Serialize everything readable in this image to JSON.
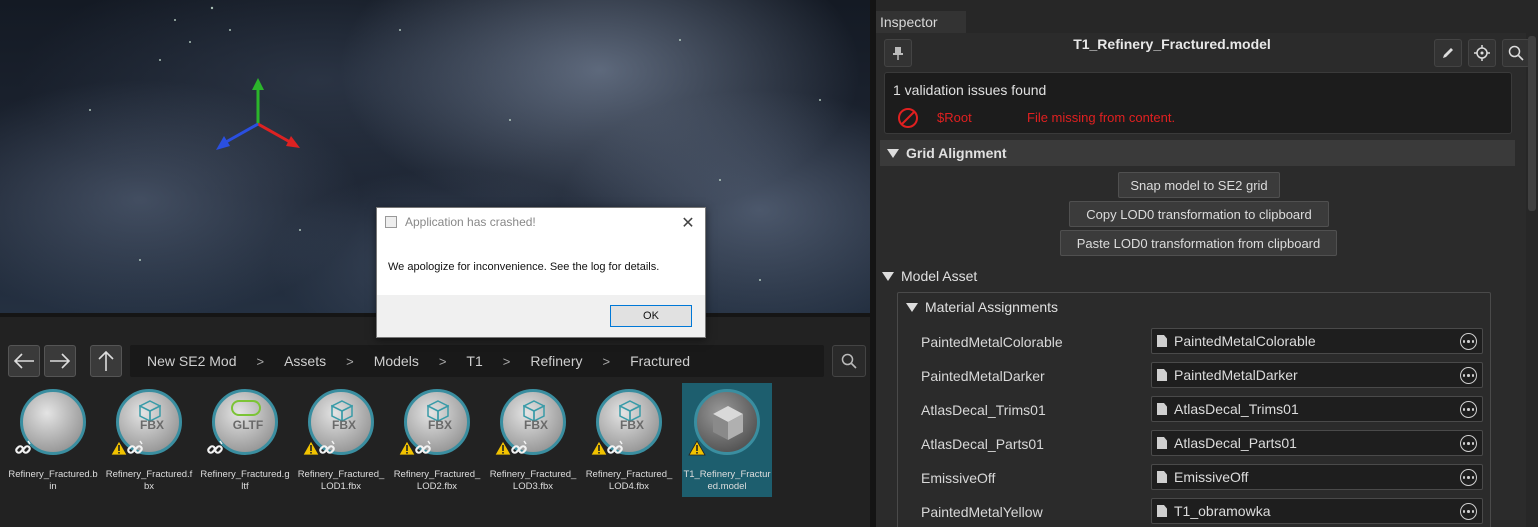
{
  "colors": {
    "accent": "#3a8ea0",
    "selection": "#1d5e6e",
    "error": "#e02020",
    "warning": "#f2c300"
  },
  "dialog": {
    "title": "Application has crashed!",
    "message": "We apologize for inconvenience. See the log for details.",
    "ok_label": "OK"
  },
  "browser": {
    "breadcrumb": [
      "New SE2 Mod",
      "Assets",
      "Models",
      "T1",
      "Refinery",
      "Fractured"
    ],
    "separator": ">",
    "files": [
      {
        "name": "Refinery_Fractured.bin",
        "glyph": "",
        "icon": "plain-sphere-icon",
        "warning": false,
        "link": true,
        "selected": false
      },
      {
        "name": "Refinery_Fractured.fbx",
        "glyph": "FBX",
        "icon": "fbx-cube-icon",
        "warning": true,
        "link": true,
        "selected": false
      },
      {
        "name": "Refinery_Fractured.gltf",
        "glyph": "GLTF",
        "icon": "gltf-icon",
        "warning": false,
        "link": true,
        "selected": false
      },
      {
        "name": "Refinery_Fractured_LOD1.fbx",
        "glyph": "FBX",
        "icon": "fbx-cube-icon",
        "warning": true,
        "link": true,
        "selected": false
      },
      {
        "name": "Refinery_Fractured_LOD2.fbx",
        "glyph": "FBX",
        "icon": "fbx-cube-icon",
        "warning": true,
        "link": true,
        "selected": false
      },
      {
        "name": "Refinery_Fractured_LOD3.fbx",
        "glyph": "FBX",
        "icon": "fbx-cube-icon",
        "warning": true,
        "link": true,
        "selected": false
      },
      {
        "name": "Refinery_Fractured_LOD4.fbx",
        "glyph": "FBX",
        "icon": "fbx-cube-icon",
        "warning": true,
        "link": true,
        "selected": false
      },
      {
        "name": "T1_Refinery_Fractured.model",
        "glyph": "",
        "icon": "model-cube-icon",
        "warning": true,
        "link": false,
        "selected": true
      }
    ]
  },
  "inspector": {
    "tab_label": "Inspector",
    "title": "T1_Refinery_Fractured.model",
    "validation": {
      "summary": "1 validation issues found",
      "path": "$Root",
      "message": "File missing from content."
    },
    "grid_alignment": {
      "header": "Grid Alignment",
      "buttons": [
        "Snap model to SE2 grid",
        "Copy LOD0 transformation to clipboard",
        "Paste LOD0 transformation from clipboard"
      ]
    },
    "model_asset_header": "Model Asset",
    "material_assignments": {
      "header": "Material Assignments",
      "rows": [
        {
          "key": "PaintedMetalColorable",
          "value": "PaintedMetalColorable"
        },
        {
          "key": "PaintedMetalDarker",
          "value": "PaintedMetalDarker"
        },
        {
          "key": "AtlasDecal_Trims01",
          "value": "AtlasDecal_Trims01"
        },
        {
          "key": "AtlasDecal_Parts01",
          "value": "AtlasDecal_Parts01"
        },
        {
          "key": "EmissiveOff",
          "value": "EmissiveOff"
        },
        {
          "key": "PaintedMetalYellow",
          "value": "T1_obramowka"
        }
      ]
    }
  }
}
